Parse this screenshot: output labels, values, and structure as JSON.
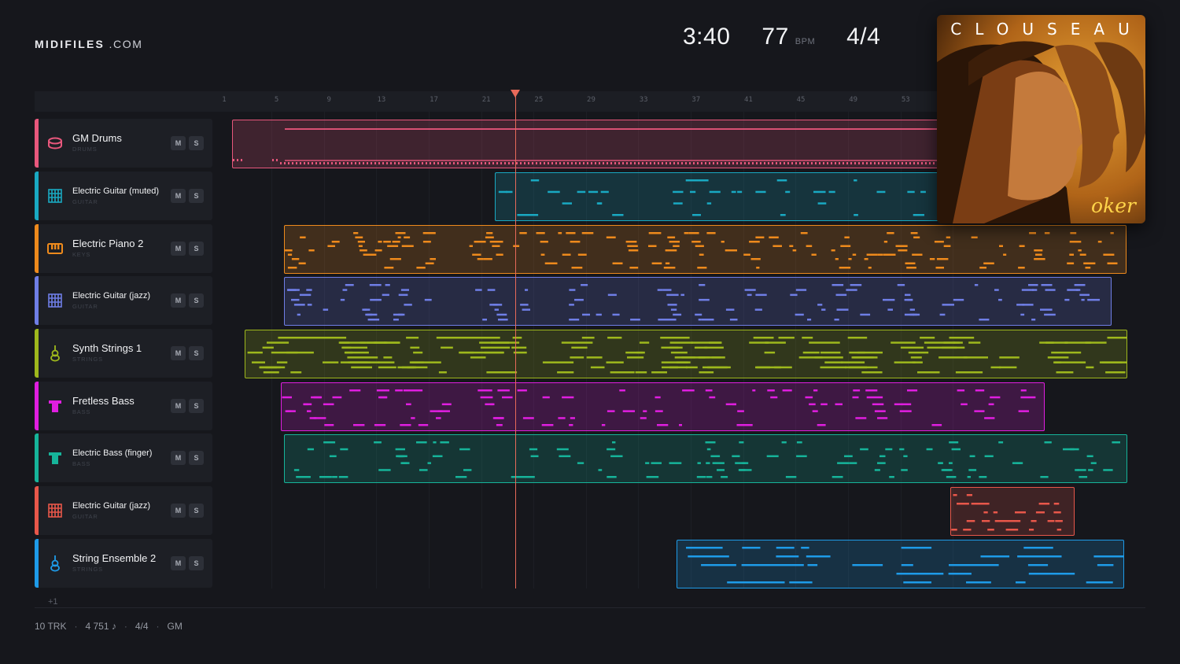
{
  "brand": {
    "bold": "MIDIFILES",
    "rest": " .COM"
  },
  "header": {
    "duration": "3:40",
    "tempo": "77",
    "tempo_unit": "BPM",
    "time_signature": "4/4"
  },
  "ruler": {
    "bars": [
      "1",
      "5",
      "9",
      "13",
      "17",
      "21",
      "25",
      "29",
      "33",
      "37",
      "41",
      "45",
      "49",
      "53"
    ]
  },
  "playhead": {
    "bar": 23
  },
  "tracks": [
    {
      "name": "GM Drums",
      "category": "DRUMS",
      "color": "#e8577c",
      "icon": "drum-icon",
      "mute": "M",
      "solo": "S",
      "small": false
    },
    {
      "name": "Electric Guitar (muted)",
      "category": "GUITAR",
      "color": "#19a9c2",
      "icon": "guitar-icon",
      "mute": "M",
      "solo": "S",
      "small": true
    },
    {
      "name": "Electric Piano 2",
      "category": "KEYS",
      "color": "#ee8a1c",
      "icon": "piano-icon",
      "mute": "M",
      "solo": "S",
      "small": false
    },
    {
      "name": "Electric Guitar (jazz)",
      "category": "GUITAR",
      "color": "#6f7ee6",
      "icon": "guitar-icon",
      "mute": "M",
      "solo": "S",
      "small": true
    },
    {
      "name": "Synth Strings 1",
      "category": "STRINGS",
      "color": "#9eb81c",
      "icon": "violin-icon",
      "mute": "M",
      "solo": "S",
      "small": false
    },
    {
      "name": "Fretless Bass",
      "category": "BASS",
      "color": "#e01ee0",
      "icon": "bass-icon",
      "mute": "M",
      "solo": "S",
      "small": false
    },
    {
      "name": "Electric Bass (finger)",
      "category": "BASS",
      "color": "#16b49a",
      "icon": "bass-icon",
      "mute": "M",
      "solo": "S",
      "small": true
    },
    {
      "name": "Electric Guitar (jazz)",
      "category": "GUITAR",
      "color": "#e8574a",
      "icon": "guitar-icon",
      "mute": "M",
      "solo": "S",
      "small": true
    },
    {
      "name": "String Ensemble 2",
      "category": "STRINGS",
      "color": "#1e9be8",
      "icon": "violin-icon",
      "mute": "M",
      "solo": "S",
      "small": false
    }
  ],
  "more_tracks": "+1",
  "footer": {
    "tracks": "10 TRK",
    "notes": "4 751 ♪",
    "time_signature": "4/4",
    "standard": "GM"
  },
  "cover": {
    "title": "CLOUSEAU",
    "subtitle": "oker"
  }
}
